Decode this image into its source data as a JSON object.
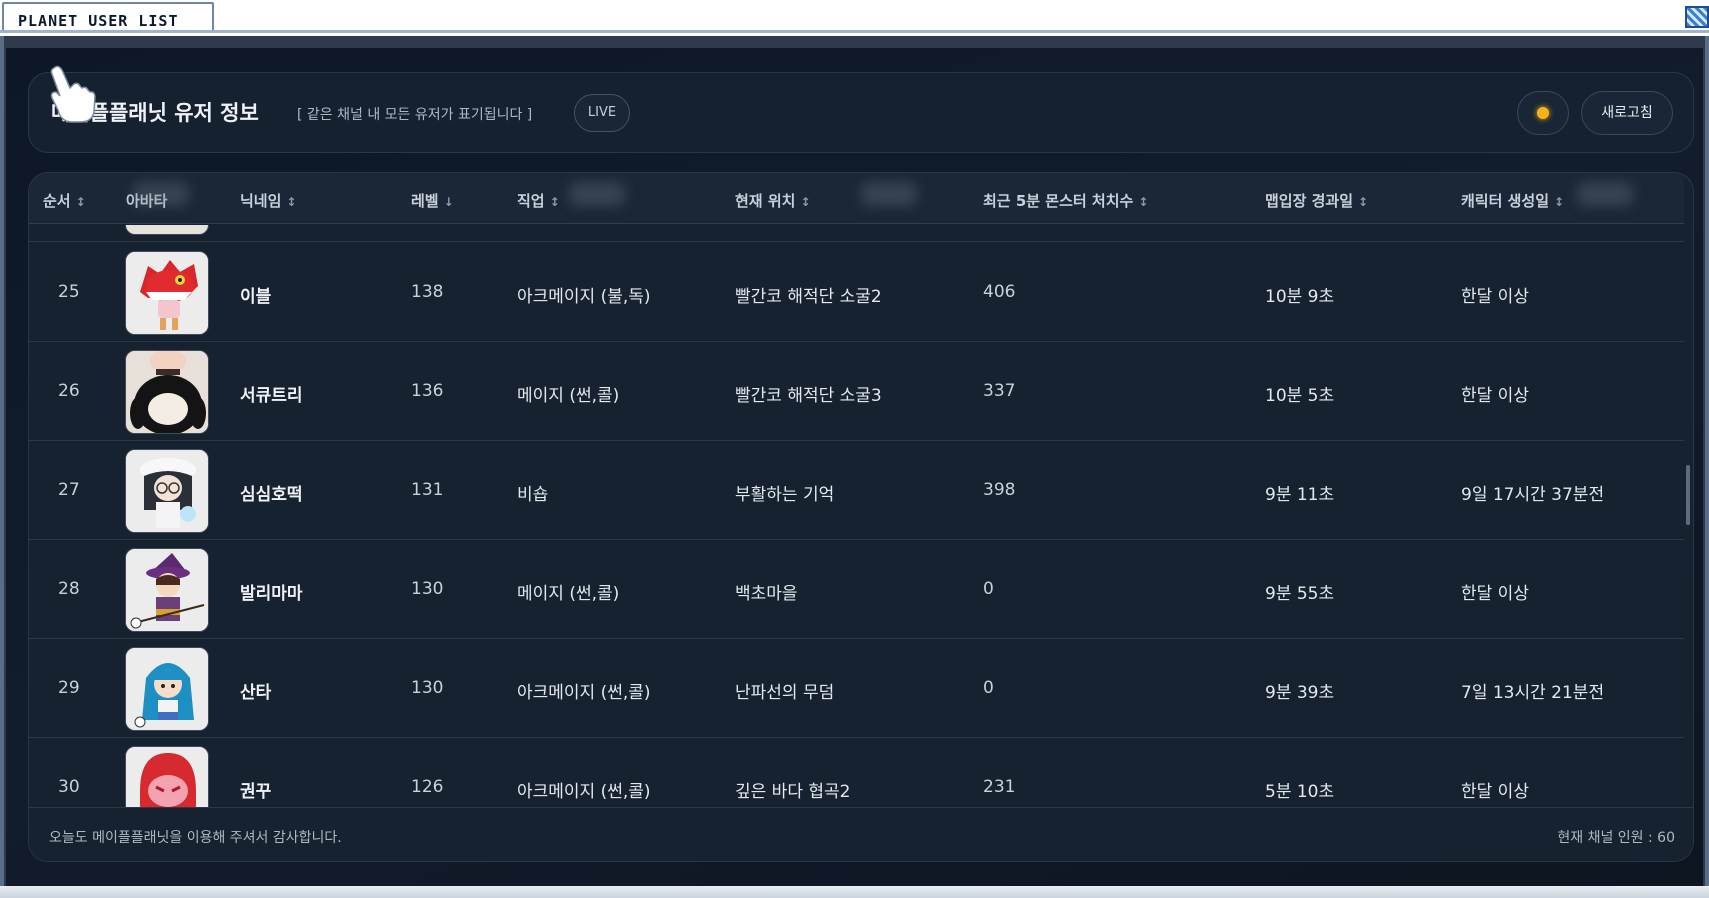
{
  "window": {
    "title": "PLANET USER LIST"
  },
  "header": {
    "title": "메이플플래닛 유저 정보",
    "subtitle": "[ 같은 채널 내 모든 유저가 표기됩니다 ]",
    "live_label": "LIVE",
    "refresh_label": "새로고침",
    "status_color": "#f6b21a"
  },
  "table": {
    "columns": [
      {
        "label": "순서",
        "sort": "↕"
      },
      {
        "label": "아바타",
        "sort": ""
      },
      {
        "label": "닉네임",
        "sort": "↕"
      },
      {
        "label": "레벨",
        "sort": "↓"
      },
      {
        "label": "직업",
        "sort": "↕"
      },
      {
        "label": "현재 위치",
        "sort": "↕"
      },
      {
        "label": "최근 5분 몬스터 처치수",
        "sort": "↕"
      },
      {
        "label": "맵입장 경과일",
        "sort": "↕"
      },
      {
        "label": "캐릭터 생성일",
        "sort": "↕"
      }
    ],
    "rows": [
      {
        "index": "25",
        "avatar": "red-dragon-hood-avatar",
        "nickname": "이블",
        "level": "138",
        "job": "아크메이지 (불,독)",
        "location": "빨간코 해적단 소굴2",
        "kills": "406",
        "map_elapsed": "10분 9초",
        "created": "한달 이상"
      },
      {
        "index": "26",
        "avatar": "penguin-suit-avatar",
        "nickname": "서큐트리",
        "level": "136",
        "job": "메이지 (썬,콜)",
        "location": "빨간코 해적단 소굴3",
        "kills": "337",
        "map_elapsed": "10분 5초",
        "created": "한달 이상"
      },
      {
        "index": "27",
        "avatar": "white-hat-glasses-avatar",
        "nickname": "심심호떡",
        "level": "131",
        "job": "비숍",
        "location": "부활하는 기억",
        "kills": "398",
        "map_elapsed": "9분 11초",
        "created": "9일 17시간 37분전"
      },
      {
        "index": "28",
        "avatar": "wizard-hat-avatar",
        "nickname": "발리마마",
        "level": "130",
        "job": "메이지 (썬,콜)",
        "location": "백초마을",
        "kills": "0",
        "map_elapsed": "9분 55초",
        "created": "한달 이상"
      },
      {
        "index": "29",
        "avatar": "blue-hair-avatar",
        "nickname": "산타",
        "level": "130",
        "job": "아크메이지 (썬,콜)",
        "location": "난파선의 무덤",
        "kills": "0",
        "map_elapsed": "9분 39초",
        "created": "7일 13시간 21분전"
      },
      {
        "index": "30",
        "avatar": "red-hood-avatar",
        "nickname": "권꾸",
        "level": "126",
        "job": "아크메이지 (썬,콜)",
        "location": "깊은 바다 협곡2",
        "kills": "231",
        "map_elapsed": "5분 10초",
        "created": "한달 이상"
      }
    ]
  },
  "footer": {
    "thanks": "오늘도 메이플플래닛을 이용해 주셔서 감사합니다.",
    "channel_count": "현재 채널 인원 : 60"
  }
}
